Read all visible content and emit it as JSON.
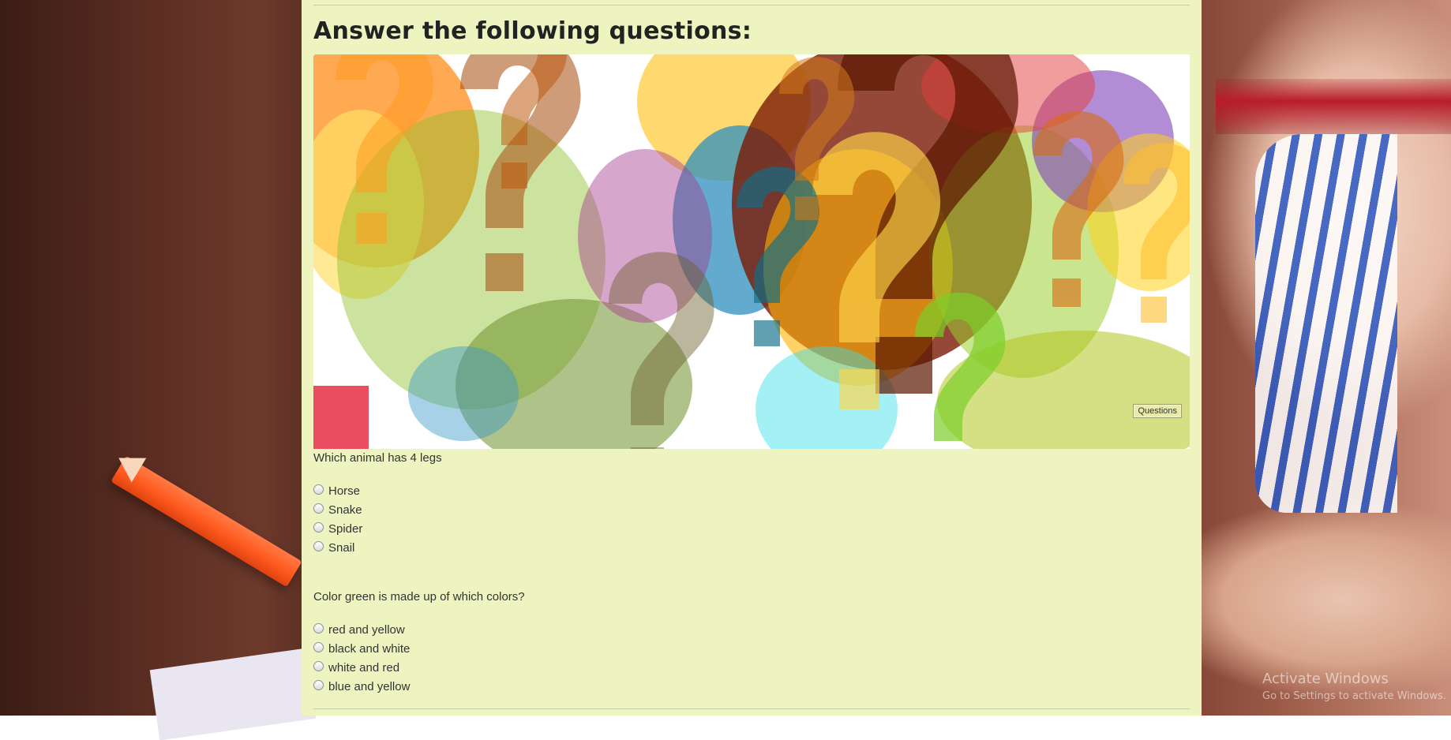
{
  "page": {
    "heading": "Answer the following questions:",
    "image_caption": "Questions"
  },
  "questions": [
    {
      "text": "Which animal has 4 legs",
      "options": [
        "Horse",
        "Snake",
        "Spider",
        "Snail"
      ]
    },
    {
      "text": "Color green is made up of which colors?",
      "options": [
        "red and yellow",
        "black and white",
        "white and red",
        "blue and yellow"
      ]
    }
  ],
  "watermark": {
    "line1": "Activate Windows",
    "line2": "Go to Settings to activate Windows."
  },
  "colors": {
    "panel_background": "#eef4c0",
    "text": "#333333"
  }
}
